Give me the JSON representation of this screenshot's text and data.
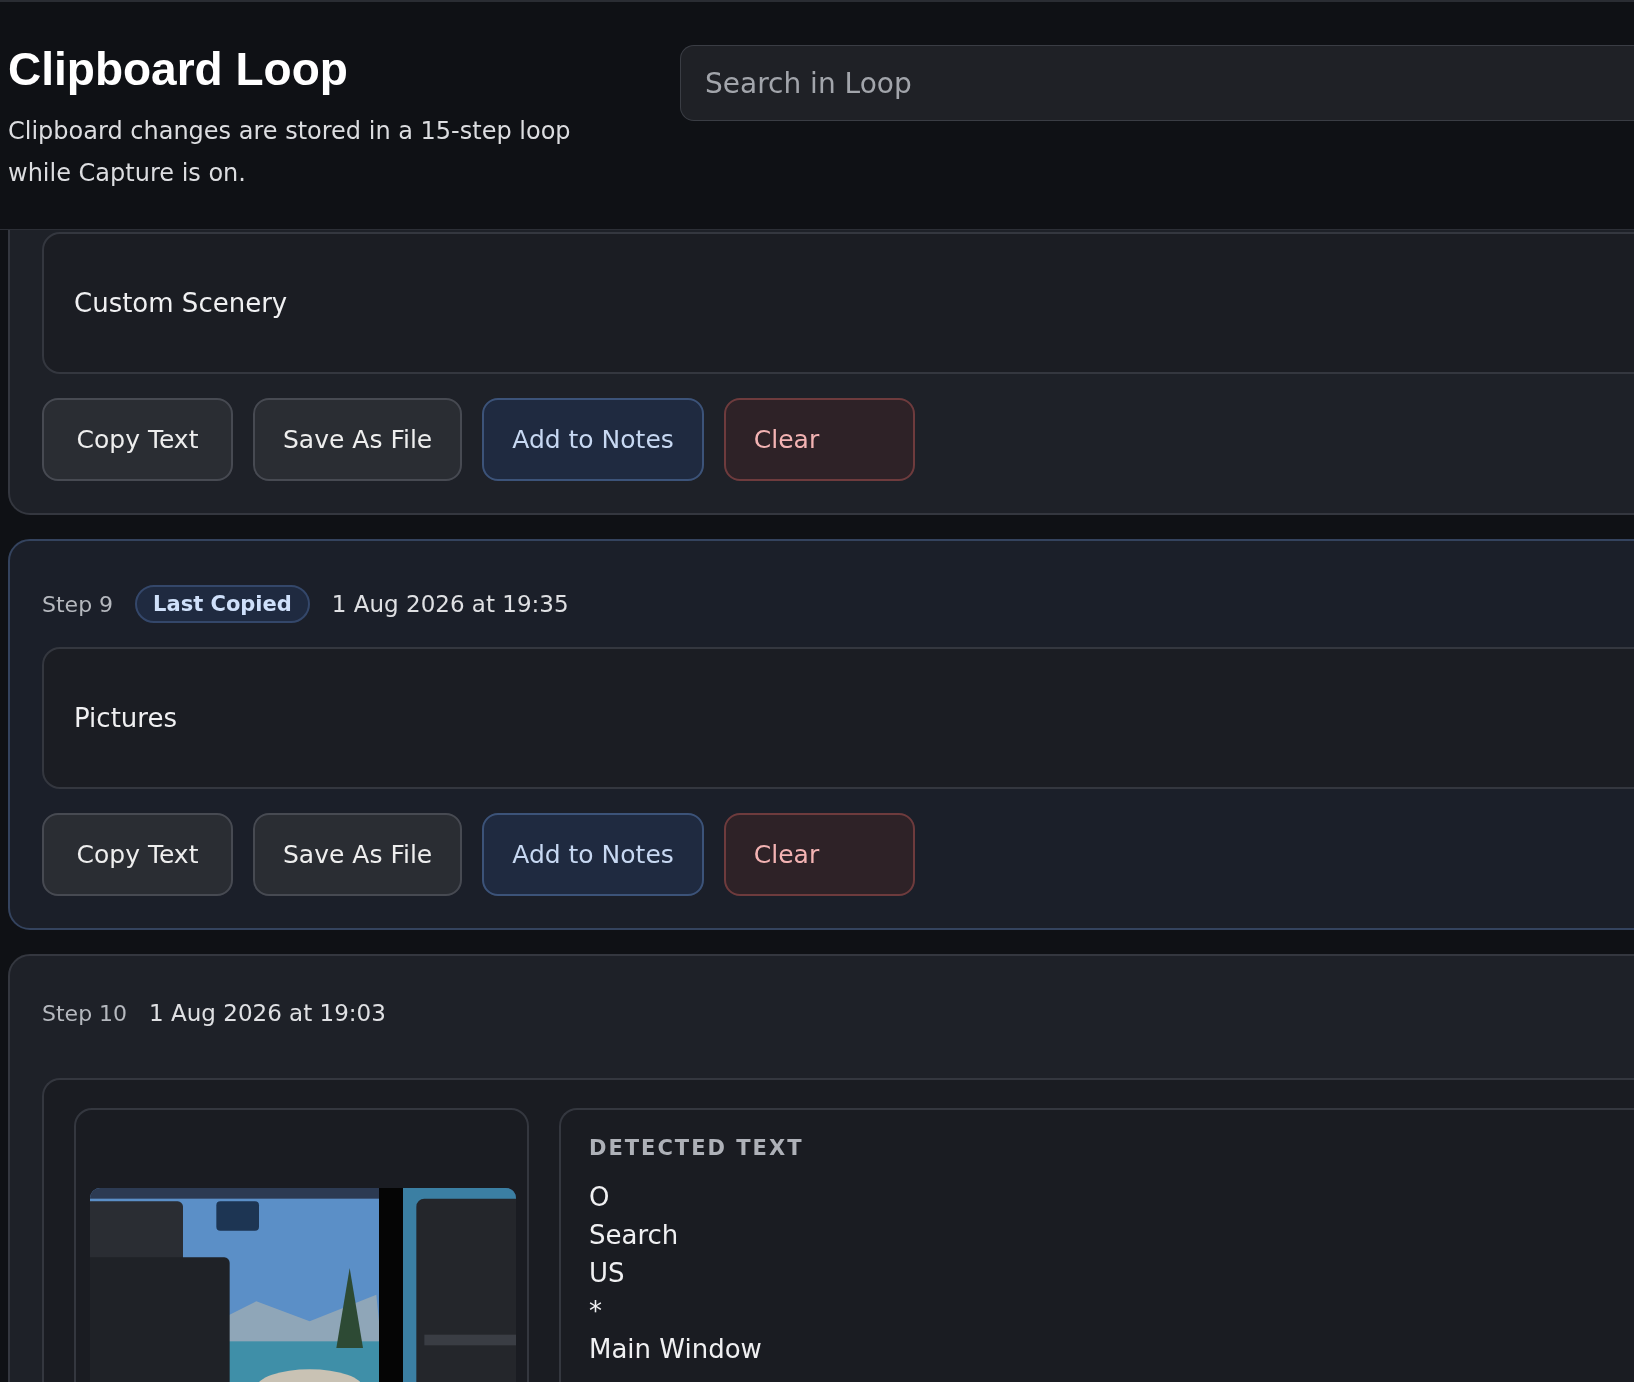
{
  "header": {
    "title": "Clipboard Loop",
    "subtitle": "Clipboard changes are stored in a 15-step loop while Capture is on."
  },
  "search": {
    "placeholder": "Search in Loop"
  },
  "entries": [
    {
      "kind": "text",
      "selected": false,
      "content": "Custom Scenery",
      "buttons": [
        {
          "label": "Copy Text",
          "kind": "default"
        },
        {
          "label": "Save As File",
          "kind": "default"
        },
        {
          "label": "Add to Notes",
          "kind": "accent"
        },
        {
          "label": "Clear",
          "kind": "danger"
        }
      ]
    },
    {
      "kind": "text",
      "selected": true,
      "step": "Step 9",
      "badge": "Last Copied",
      "time": "1 Aug 2026 at 19:35",
      "content": "Pictures",
      "buttons": [
        {
          "label": "Copy Text",
          "kind": "default"
        },
        {
          "label": "Save As File",
          "kind": "default"
        },
        {
          "label": "Add to Notes",
          "kind": "accent"
        },
        {
          "label": "Clear",
          "kind": "danger"
        }
      ]
    },
    {
      "selected": false,
      "step": "Step 10",
      "time": "1 Aug 2026 at 19:03",
      "detected_label": "DETECTED TEXT",
      "detected_lines": [
        "O",
        "Search",
        "US",
        "*",
        "Main Window"
      ]
    }
  ]
}
